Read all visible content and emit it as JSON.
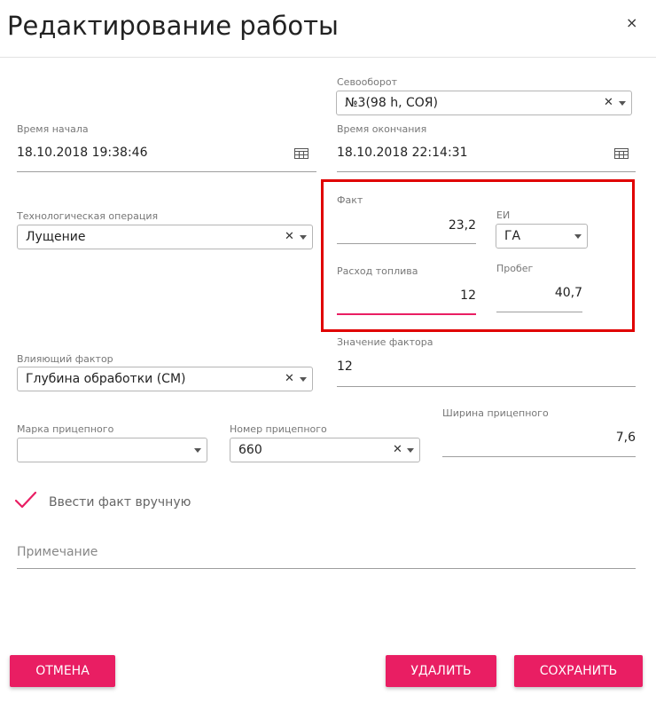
{
  "dialog": {
    "title": "Редактирование работы",
    "close": "×"
  },
  "crop_rotation": {
    "label": "Севооборот",
    "value": "№3(98 h, СОЯ)"
  },
  "start_time": {
    "label": "Время начала",
    "value": "18.10.2018 19:38:46"
  },
  "end_time": {
    "label": "Время окончания",
    "value": "18.10.2018 22:14:31"
  },
  "operation": {
    "label": "Технологическая операция",
    "value": "Лущение"
  },
  "fact": {
    "label": "Факт",
    "value": "23,2"
  },
  "unit": {
    "label": "ЕИ",
    "value": "ГА"
  },
  "fuel": {
    "label": "Расход топлива",
    "value": "12"
  },
  "mileage": {
    "label": "Пробег",
    "value": "40,7"
  },
  "factor": {
    "label": "Влияющий фактор",
    "value": "Глубина обработки (СМ)"
  },
  "factor_value": {
    "label": "Значение фактора",
    "value": "12"
  },
  "trailer_brand": {
    "label": "Марка прицепного",
    "value": ""
  },
  "trailer_number": {
    "label": "Номер прицепного",
    "value": "660"
  },
  "trailer_width": {
    "label": "Ширина прицепного",
    "value": "7,6"
  },
  "manual_fact": {
    "label": "Ввести факт вручную",
    "checked": true
  },
  "note": {
    "placeholder": "Примечание"
  },
  "buttons": {
    "cancel": "ОТМЕНА",
    "delete": "УДАЛИТЬ",
    "save": "СОХРАНИТЬ"
  },
  "colors": {
    "accent": "#e91e63",
    "highlight": "#e00000"
  },
  "icons": {
    "calendar": "calendar-icon",
    "clear": "clear-icon",
    "caret": "caret-down-icon",
    "check": "check-icon"
  }
}
